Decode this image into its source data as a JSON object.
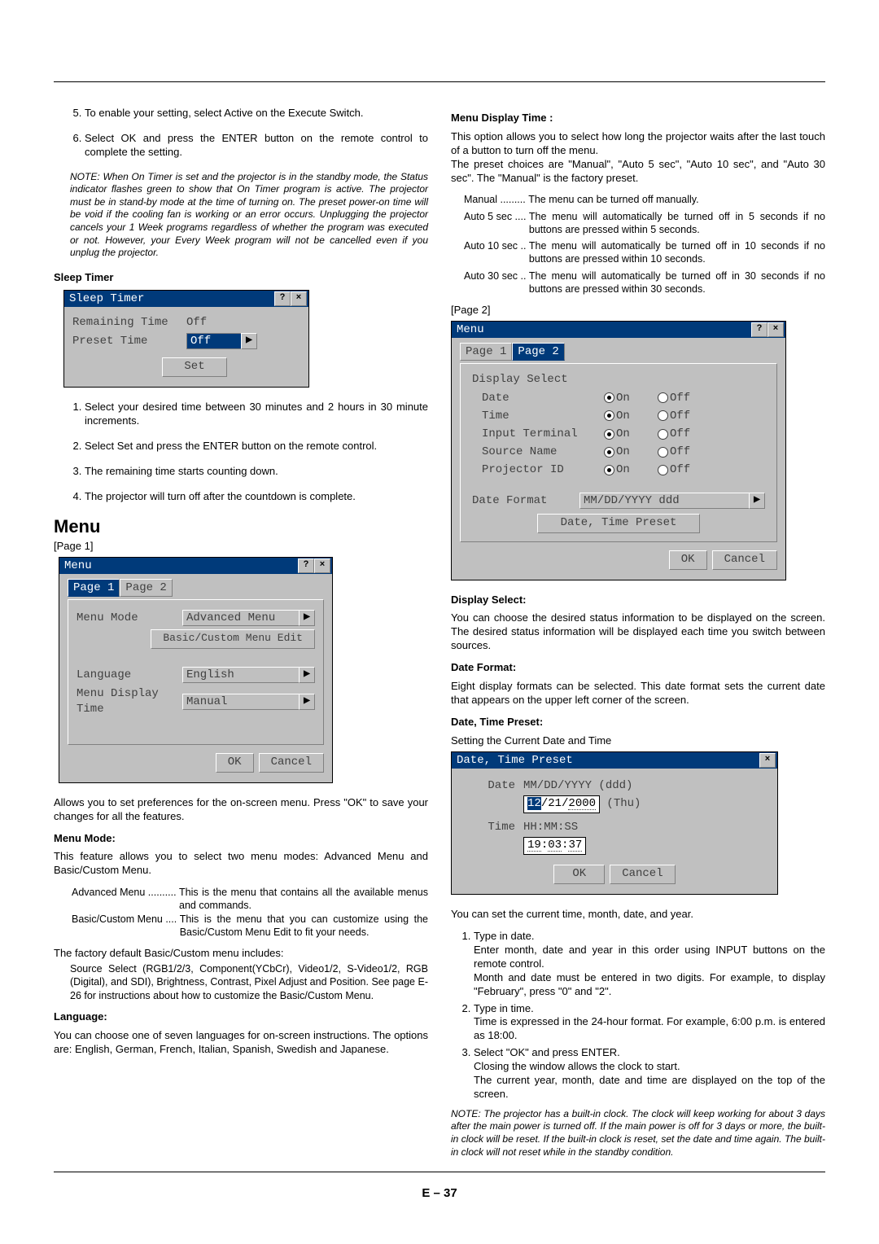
{
  "left": {
    "steps_top": [
      "To enable your setting, select Active on the Execute Switch.",
      "Select OK and press the ENTER button on the remote control to complete the setting."
    ],
    "note1": "NOTE: When On Timer is set and the projector is in the standby mode, the Status indicator flashes green to show that On Timer program is active. The projector must be in stand-by mode at the time of turning on. The preset power-on time will be void if the cooling fan is working or an error occurs. Unplugging the projector cancels your 1 Week programs regardless of whether the program was executed or not. However, your Every Week program will not be cancelled even if you unplug the projector.",
    "sleep_timer": {
      "title": "Sleep Timer",
      "dlg_title": "Sleep Timer",
      "remaining_label": "Remaining Time",
      "remaining_value": "Off",
      "preset_label": "Preset Time",
      "preset_value": "Off",
      "set_btn": "Set",
      "steps": [
        "Select your desired time between 30 minutes and 2 hours in 30 minute increments.",
        "Select Set and press the ENTER button on the remote control.",
        "The remaining time starts counting down.",
        "The projector will turn off after the countdown is complete."
      ]
    },
    "menu_head": "Menu",
    "page1_label": "[Page 1]",
    "menu_dlg": {
      "title": "Menu",
      "tab1": "Page 1",
      "tab2": "Page 2",
      "menu_mode_label": "Menu Mode",
      "menu_mode_value": "Advanced Menu",
      "edit_btn": "Basic/Custom Menu Edit",
      "language_label": "Language",
      "language_value": "English",
      "display_time_label": "Menu Display Time",
      "display_time_value": "Manual",
      "ok": "OK",
      "cancel": "Cancel"
    },
    "after_menu_dlg": "Allows you to set preferences for the on-screen menu. Press \"OK\" to save your changes for all the features.",
    "menu_mode_head": "Menu Mode:",
    "menu_mode_text": "This feature allows you to select two menu modes: Advanced Menu and Basic/Custom Menu.",
    "menu_mode_defs": [
      {
        "term": "Advanced Menu .......... ",
        "desc": "This is the menu that contains all the available menus and commands."
      },
      {
        "term": "Basic/Custom Menu .... ",
        "desc": "This is the menu that you can customize using the Basic/Custom Menu Edit to fit your needs."
      }
    ],
    "factory_default_head": "The factory default Basic/Custom menu includes:",
    "factory_default_text": "Source Select (RGB1/2/3, Component(YCbCr), Video1/2, S-Video1/2, RGB (Digital), and SDI), Brightness, Contrast, Pixel Adjust and Position. See page E-26 for instructions about how to customize the Basic/Custom Menu.",
    "language_head": "Language:",
    "language_text": "You can choose one of seven languages for on-screen instructions. The options are: English, German, French, Italian, Spanish, Swedish and Japanese."
  },
  "right": {
    "menu_display_time_head": "Menu Display Time :",
    "menu_display_time_text": "This option allows you to select how long the projector waits after the last touch of a button to turn off the menu.\nThe preset choices are \"Manual\", \"Auto 5 sec\", \"Auto 10 sec\", and \"Auto 30 sec\". The \"Manual\" is the factory preset.",
    "mdt_defs": [
      {
        "term": "Manual ......... ",
        "desc": "The menu can be turned off manually."
      },
      {
        "term": "Auto 5 sec .... ",
        "desc": "The menu will automatically be turned off in 5 seconds if no buttons are pressed within 5 seconds."
      },
      {
        "term": "Auto 10 sec .. ",
        "desc": "The menu will automatically be turned off in 10 seconds if no buttons are pressed within 10 seconds."
      },
      {
        "term": "Auto 30 sec .. ",
        "desc": "The menu will automatically be turned off in 30 seconds if no buttons are pressed within 30 seconds."
      }
    ],
    "page2_label": "[Page 2]",
    "page2_dlg": {
      "title": "Menu",
      "tab1": "Page 1",
      "tab2": "Page 2",
      "display_select_label": "Display Select",
      "rows": [
        {
          "label": "Date",
          "on": "On",
          "off": "Off"
        },
        {
          "label": "Time",
          "on": "On",
          "off": "Off"
        },
        {
          "label": "Input Terminal",
          "on": "On",
          "off": "Off"
        },
        {
          "label": "Source Name",
          "on": "On",
          "off": "Off"
        },
        {
          "label": "Projector ID",
          "on": "On",
          "off": "Off"
        }
      ],
      "date_format_label": "Date Format",
      "date_format_value": "MM/DD/YYYY ddd",
      "preset_btn": "Date, Time Preset",
      "ok": "OK",
      "cancel": "Cancel"
    },
    "display_select_head": "Display Select:",
    "display_select_text": "You can choose the desired status information to be displayed on the screen. The desired status information will be displayed each time you switch between sources.",
    "date_format_head": "Date Format:",
    "date_format_text": "Eight display formats can be selected. This date format sets the current date that appears on the upper left corner of the screen.",
    "date_time_preset_head": "Date, Time Preset:",
    "date_time_preset_text": "Setting the Current Date and Time",
    "dtp_dlg": {
      "title": "Date, Time Preset",
      "date_label": "Date",
      "date_format": "MM/DD/YYYY (ddd)",
      "date_hl": "12",
      "date_rest": "/21/",
      "date_year": "2000",
      "date_day": " (Thu)",
      "time_label": "Time",
      "time_format": "HH:MM:SS",
      "time_value": "19:03:37",
      "time_hh": "19",
      "time_mm": "03",
      "time_ss": "37",
      "ok": "OK",
      "cancel": "Cancel"
    },
    "after_dtp": "You can set the current time, month, date, and year.",
    "dtp_steps": [
      "Type in date.\nEnter month, date and year in this order using INPUT buttons on the remote control.\nMonth and date must be entered in two digits. For example, to display \"February\", press \"0\" and \"2\".",
      "Type in time.\nTime is expressed in the 24-hour format. For example, 6:00 p.m. is entered as 18:00.",
      "Select \"OK\" and press ENTER.\nClosing the window allows the clock to start.\nThe current year, month, date and time are displayed on the top of the screen."
    ],
    "note2": "NOTE: The projector has a built-in clock. The clock will keep working for about 3 days after the main power is turned off. If the main power is off for 3 days or more, the built-in clock will be reset. If the built-in clock is reset, set the date and time again. The built-in clock will not reset while in the standby condition."
  },
  "page_number": "E – 37"
}
